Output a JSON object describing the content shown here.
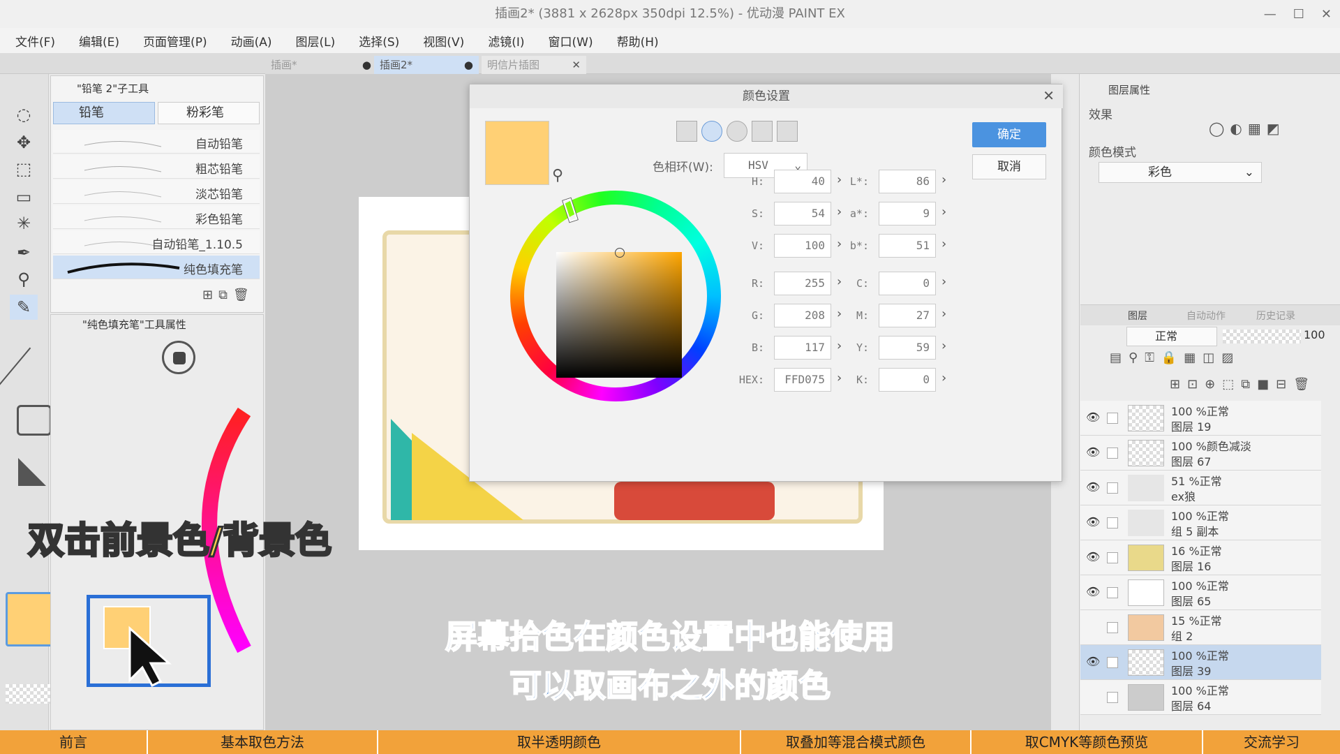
{
  "window": {
    "title": "插画2* (3881 x 2628px 350dpi 12.5%) - 优动漫 PAINT EX"
  },
  "menu": [
    "文件(F)",
    "编辑(E)",
    "页面管理(P)",
    "动画(A)",
    "图层(L)",
    "选择(S)",
    "视图(V)",
    "滤镜(I)",
    "窗口(W)",
    "帮助(H)"
  ],
  "tabs": [
    {
      "label": "插画*"
    },
    {
      "label": "插画2*"
    },
    {
      "label": "明信片插图"
    }
  ],
  "sub_tool": {
    "panel_title": "\"铅笔 2\"子工具",
    "groups": [
      "铅笔",
      "粉彩笔"
    ],
    "brushes": [
      "自动铅笔",
      "粗芯铅笔",
      "淡芯铅笔",
      "彩色铅笔",
      "自动铅笔_1.10.5",
      "纯色填充笔"
    ],
    "props_title": "\"纯色填充笔\"工具属性"
  },
  "color_dialog": {
    "title": "颜色设置",
    "ok": "确定",
    "cancel": "取消",
    "wheel_label": "色相环(W):",
    "wheel_mode": "HSV",
    "swatch_color": "#FFD075",
    "left_fields": [
      {
        "label": "H:",
        "value": "40"
      },
      {
        "label": "S:",
        "value": "54"
      },
      {
        "label": "V:",
        "value": "100"
      },
      {
        "label": "R:",
        "value": "255"
      },
      {
        "label": "G:",
        "value": "208"
      },
      {
        "label": "B:",
        "value": "117"
      },
      {
        "label": "HEX:",
        "value": "FFD075"
      }
    ],
    "right_fields": [
      {
        "label": "L*:",
        "value": "86"
      },
      {
        "label": "a*:",
        "value": "9"
      },
      {
        "label": "b*:",
        "value": "51"
      },
      {
        "label": "C:",
        "value": "0"
      },
      {
        "label": "M:",
        "value": "27"
      },
      {
        "label": "Y:",
        "value": "59"
      },
      {
        "label": "K:",
        "value": "0"
      }
    ]
  },
  "layer_props": {
    "tab": "图层属性",
    "effect_label": "效果",
    "color_mode_label": "颜色模式",
    "color_mode_value": "彩色"
  },
  "layers_panel": {
    "tabs": [
      "图层",
      "自动动作",
      "历史记录"
    ],
    "blend_mode": "正常",
    "opacity": "100",
    "layers": [
      {
        "line1": "100 %正常",
        "line2": "图层 19"
      },
      {
        "line1": "100 %颜色减淡",
        "line2": "图层 67"
      },
      {
        "line1": "51 %正常",
        "line2": "ex狼"
      },
      {
        "line1": "100 %正常",
        "line2": "组 5 副本"
      },
      {
        "line1": "16 %正常",
        "line2": "图层 16"
      },
      {
        "line1": "100 %正常",
        "line2": "图层 65"
      },
      {
        "line1": "15 %正常",
        "line2": "组 2"
      },
      {
        "line1": "100 %正常",
        "line2": "图层 39"
      },
      {
        "line1": "100 %正常",
        "line2": "图层 64"
      }
    ]
  },
  "captions": {
    "yellow": "双击前景色/背景色",
    "blue_line1": "屏幕拾色在颜色设置中也能使用",
    "blue_line2": "可以取画布之外的颜色"
  },
  "chapters": [
    "前言",
    "基本取色方法",
    "取半透明颜色",
    "取叠加等混合模式颜色",
    "取CMYK等颜色预览",
    "交流学习"
  ],
  "colors": {
    "foreground": "#FFD075",
    "highlight_box": "#2a6fd6",
    "chapter_bar": "#F2A23A"
  }
}
